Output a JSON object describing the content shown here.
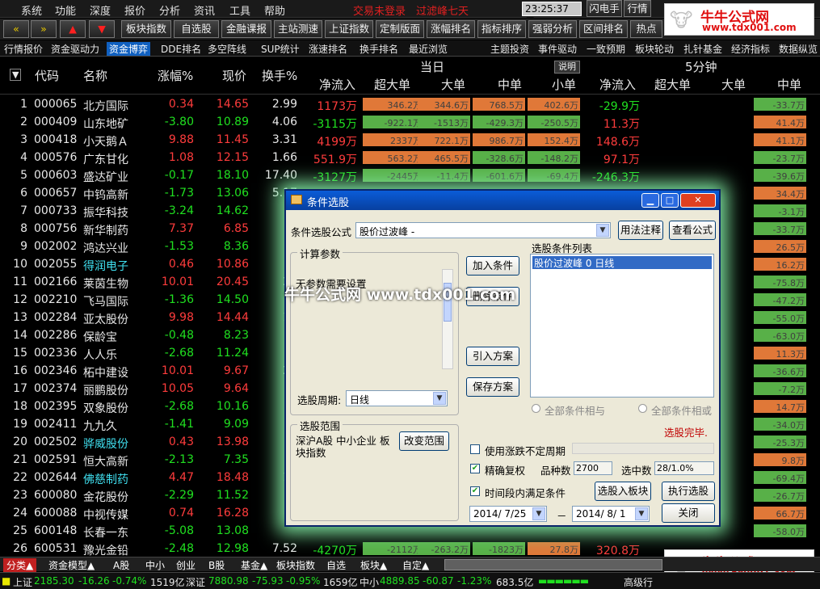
{
  "menu": {
    "items": [
      "系统",
      "功能",
      "深度",
      "报价",
      "分析",
      "资讯",
      "工具",
      "帮助"
    ],
    "status": "交易未登录　过滤峰七天",
    "clock": "23:25:37 周五",
    "right": [
      "闪电手",
      "行情"
    ]
  },
  "toolbar": {
    "items": [
      "板块指数",
      "自选股",
      "金融课报",
      "主站测速",
      "上证指数",
      "定制版面",
      "涨幅排名",
      "指标排序",
      "强弱分析",
      "区间排名",
      "热点"
    ]
  },
  "tabs": [
    "行情报价",
    "资金驱动力",
    "资金博弈",
    "DDE排名",
    "多空阵线",
    "SUP统计",
    "涨速排名",
    "换手排名",
    "最近浏览",
    "主题投资",
    "事件驱动",
    "一致预期",
    "板块轮动",
    "扎针基金",
    "经济指标",
    "数据纵览"
  ],
  "header": {
    "section_day": "当日",
    "section_5min": "5分钟",
    "explain": "说明",
    "cols": [
      "代码",
      "名称",
      "涨幅%",
      "现价",
      "换手%",
      "净流入",
      "超大单",
      "大单",
      "中单",
      "小单",
      "净流入",
      "超大单",
      "大单",
      "中单"
    ]
  },
  "rows": [
    {
      "n": "1",
      "code": "000065",
      "name": "北方国际",
      "chg": "0.34",
      "price": "14.65",
      "turn": "2.99",
      "net": "1173万",
      "b1": "346.2万",
      "b2": "344.6万",
      "b3": "768.5万",
      "b4": "402.6万",
      "net5": "-29.9万",
      "c5": "-33.7万"
    },
    {
      "n": "2",
      "code": "000409",
      "name": "山东地矿",
      "chg": "-3.80",
      "price": "10.89",
      "turn": "4.06",
      "net": "-3115万",
      "b1": "-922.1万",
      "b2": "-1513万",
      "b3": "-429.3万",
      "b4": "-250.5万",
      "net5": "11.3万",
      "c5": "41.4万"
    },
    {
      "n": "3",
      "code": "000418",
      "name": "小天鹅Ａ",
      "chg": "9.88",
      "price": "11.45",
      "turn": "3.31",
      "net": "4199万",
      "b1": "2337万",
      "b2": "722.1万",
      "b3": "986.7万",
      "b4": "152.4万",
      "net5": "148.6万",
      "c5": "41.1万"
    },
    {
      "n": "4",
      "code": "000576",
      "name": "广东甘化",
      "chg": "1.08",
      "price": "12.15",
      "turn": "1.66",
      "net": "551.9万",
      "b1": "563.2万",
      "b2": "465.5万",
      "b3": "-328.6万",
      "b4": "-148.2万",
      "net5": "97.1万",
      "c5": "-23.7万"
    },
    {
      "n": "5",
      "code": "000603",
      "name": "盛达矿业",
      "chg": "-0.17",
      "price": "18.10",
      "turn": "17.40",
      "net": "-3127万",
      "b1": "-2445万",
      "b2": "-11.4万",
      "b3": "-601.6万",
      "b4": "-69.4万",
      "net5": "-246.3万",
      "c5": "-39.6万"
    },
    {
      "n": "6",
      "code": "000657",
      "name": "中钨高新",
      "chg": "-1.73",
      "price": "13.06",
      "turn": "5.17",
      "net": "",
      "b1": "",
      "b2": "",
      "b3": "",
      "b4": "",
      "net5": "",
      "c5": "34.4万"
    },
    {
      "n": "7",
      "code": "000733",
      "name": "振华科技",
      "chg": "-3.24",
      "price": "14.62",
      "turn": "",
      "net": "",
      "b1": "",
      "b2": "",
      "b3": "",
      "b4": "",
      "net5": "",
      "c5": "-3.1万"
    },
    {
      "n": "8",
      "code": "000756",
      "name": "新华制药",
      "chg": "7.37",
      "price": "6.85",
      "turn": "",
      "net": "",
      "b1": "",
      "b2": "",
      "b3": "",
      "b4": "",
      "net5": "",
      "c5": "-33.7万"
    },
    {
      "n": "9",
      "code": "002002",
      "name": "鸿达兴业",
      "chg": "-1.53",
      "price": "8.36",
      "turn": "",
      "net": "",
      "b1": "",
      "b2": "",
      "b3": "",
      "b4": "",
      "net5": "",
      "c5": "26.5万"
    },
    {
      "n": "10",
      "code": "002055",
      "name": "得润电子",
      "chg": "0.46",
      "price": "10.86",
      "turn": "",
      "net": "",
      "b1": "",
      "b2": "",
      "b3": "",
      "b4": "",
      "net5": "",
      "c5": "16.2万"
    },
    {
      "n": "11",
      "code": "002166",
      "name": "莱茵生物",
      "chg": "10.01",
      "price": "20.45",
      "turn": "20",
      "net": "",
      "b1": "",
      "b2": "",
      "b3": "",
      "b4": "",
      "net5": "",
      "c5": "-75.8万"
    },
    {
      "n": "12",
      "code": "002210",
      "name": "飞马国际",
      "chg": "-1.36",
      "price": "14.50",
      "turn": "",
      "net": "",
      "b1": "",
      "b2": "",
      "b3": "",
      "b4": "",
      "net5": "",
      "c5": "-47.2万"
    },
    {
      "n": "13",
      "code": "002284",
      "name": "亚太股份",
      "chg": "9.98",
      "price": "14.44",
      "turn": "14",
      "net": "",
      "b1": "",
      "b2": "",
      "b3": "",
      "b4": "",
      "net5": "",
      "c5": "-55.0万"
    },
    {
      "n": "14",
      "code": "002286",
      "name": "保龄宝",
      "chg": "-0.48",
      "price": "8.23",
      "turn": "",
      "net": "",
      "b1": "",
      "b2": "",
      "b3": "",
      "b4": "",
      "net5": "",
      "c5": "-63.0万"
    },
    {
      "n": "15",
      "code": "002336",
      "name": "人人乐",
      "chg": "-2.68",
      "price": "11.24",
      "turn": "",
      "net": "",
      "b1": "",
      "b2": "",
      "b3": "",
      "b4": "",
      "net5": "",
      "c5": "11.3万"
    },
    {
      "n": "16",
      "code": "002346",
      "name": "柘中建设",
      "chg": "10.01",
      "price": "9.67",
      "turn": "22",
      "net": "",
      "b1": "",
      "b2": "",
      "b3": "",
      "b4": "",
      "net5": "",
      "c5": "-36.6万"
    },
    {
      "n": "17",
      "code": "002374",
      "name": "丽鹏股份",
      "chg": "10.05",
      "price": "9.64",
      "turn": "",
      "net": "",
      "b1": "",
      "b2": "",
      "b3": "",
      "b4": "",
      "net5": "",
      "c5": "-7.2万"
    },
    {
      "n": "18",
      "code": "002395",
      "name": "双象股份",
      "chg": "-2.68",
      "price": "10.16",
      "turn": "",
      "net": "",
      "b1": "",
      "b2": "",
      "b3": "",
      "b4": "",
      "net5": "",
      "c5": "14.7万"
    },
    {
      "n": "19",
      "code": "002411",
      "name": "九九久",
      "chg": "-1.41",
      "price": "9.09",
      "turn": "",
      "net": "",
      "b1": "",
      "b2": "",
      "b3": "",
      "b4": "",
      "net5": "",
      "c5": "-34.0万"
    },
    {
      "n": "20",
      "code": "002502",
      "name": "骅威股份",
      "chg": "0.43",
      "price": "13.98",
      "turn": "",
      "net": "",
      "b1": "",
      "b2": "",
      "b3": "",
      "b4": "",
      "net5": "",
      "c5": "-25.3万"
    },
    {
      "n": "21",
      "code": "002591",
      "name": "恒大高新",
      "chg": "-2.13",
      "price": "7.35",
      "turn": "",
      "net": "",
      "b1": "",
      "b2": "",
      "b3": "",
      "b4": "",
      "net5": "",
      "c5": "9.8万"
    },
    {
      "n": "22",
      "code": "002644",
      "name": "佛慈制药",
      "chg": "4.47",
      "price": "18.48",
      "turn": "15",
      "net": "",
      "b1": "",
      "b2": "",
      "b3": "",
      "b4": "",
      "net5": "",
      "c5": "-69.4万"
    },
    {
      "n": "23",
      "code": "600080",
      "name": "金花股份",
      "chg": "-2.29",
      "price": "11.52",
      "turn": "",
      "net": "",
      "b1": "",
      "b2": "",
      "b3": "",
      "b4": "",
      "net5": "",
      "c5": "-26.7万"
    },
    {
      "n": "24",
      "code": "600088",
      "name": "中视传媒",
      "chg": "0.74",
      "price": "16.28",
      "turn": "",
      "net": "",
      "b1": "",
      "b2": "",
      "b3": "",
      "b4": "",
      "net5": "",
      "c5": "66.7万"
    },
    {
      "n": "25",
      "code": "600148",
      "name": "长春一东",
      "chg": "-5.08",
      "price": "13.08",
      "turn": "",
      "net": "",
      "b1": "",
      "b2": "",
      "b3": "",
      "b4": "",
      "net5": "",
      "c5": "-58.0万"
    },
    {
      "n": "26",
      "code": "600531",
      "name": "豫光金铅",
      "chg": "-2.48",
      "price": "12.98",
      "turn": "7.52",
      "net": "-4270万",
      "b1": "-2112万",
      "b2": "-263.2万",
      "b3": "-1823万",
      "b4": "27.8万",
      "net5": "320.8万",
      "c5": ""
    }
  ],
  "dialog": {
    "title": "条件选股",
    "formula_label": "条件选股公式",
    "formula": "股价过波峰 -",
    "usage": "用法注释",
    "view": "查看公式",
    "params_title": "计算参数",
    "params_text": "无参数需要设置",
    "add": "加入条件",
    "del": "删除条件",
    "import": "引入方案",
    "save": "保存方案",
    "list_title": "选股条件列表",
    "list_item": "股价过波峰 0 日线",
    "period_label": "选股周期:",
    "period": "日线",
    "and": "全部条件相与",
    "or": "全部条件相或",
    "done": "选股完毕.",
    "range_title": "选股范围",
    "range_text": "深沪A股 中小企业 板块指数",
    "change_range": "改变范围",
    "use_period": "使用涨跌不定周期",
    "adjust": "精确复权",
    "count_label": "品种数",
    "count": "2700",
    "selected_label": "选中数",
    "selected": "28/1.0%",
    "in_period": "时间段内满足条件",
    "to_block": "选股入板块",
    "run": "执行选股",
    "close": "关闭",
    "date_from": "2014/ 7/25",
    "date_to": "2014/ 8/ 1",
    "dash": "－"
  },
  "bottom": {
    "items": [
      "分类▲",
      "资金模型▲",
      "A股",
      "中小",
      "创业",
      "B股",
      "基金▲",
      "板块指数",
      "自选",
      "板块▲",
      "自定▲"
    ]
  },
  "status": {
    "sh": "上证",
    "sh_v": "2185.30",
    "sh_c": "-16.26",
    "sh_p": "-0.74%",
    "sh_a": "1519亿",
    "sz": "深证",
    "sz_v": "7880.98",
    "sz_c": "-75.93",
    "sz_p": "-0.95%",
    "sz_a": "1659亿",
    "zx": "中小",
    "zx_v": "4889.85",
    "zx_c": "-60.87",
    "zx_p": "-1.23%",
    "zx_a": "683.5亿",
    "adv": "高级行"
  },
  "brand": {
    "title": "牛牛公式网",
    "url": "www.tdx001.com"
  },
  "watermark": "牛牛公式网 www.tdx001.com"
}
